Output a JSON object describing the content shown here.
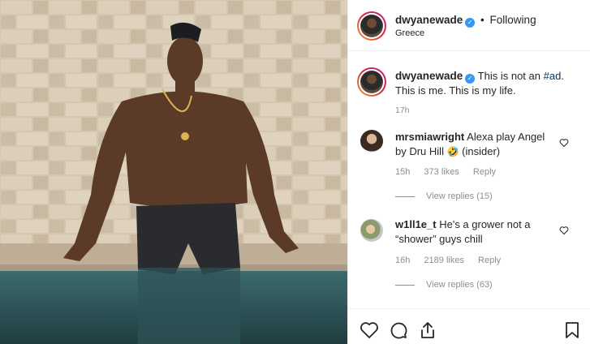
{
  "post": {
    "username": "dwyanewade",
    "follow_dot": "•",
    "follow_status": "Following",
    "location": "Greece",
    "verified_icon": "verified-badge-icon",
    "caption": {
      "username": "dwyanewade",
      "text_before": "This is not an ",
      "hashtag": "#ad",
      "text_after": ". This is me. This is my life.",
      "time": "17h"
    }
  },
  "comments": [
    {
      "username": "mrsmiawright",
      "text_before": "Alexa play Angel by Dru Hill ",
      "emoji": "🤣",
      "text_after": " (insider)",
      "time": "15h",
      "likes": "373 likes",
      "reply_label": "Reply",
      "view_replies": "View replies (15)"
    },
    {
      "username": "w1ll1e_t",
      "text": "He's a grower not a “shower” guys chill",
      "time": "16h",
      "likes": "2189 likes",
      "reply_label": "Reply",
      "view_replies": "View replies (63)"
    }
  ],
  "actions": {
    "icons": [
      "heart-icon",
      "comment-icon",
      "share-icon",
      "bookmark-icon"
    ]
  },
  "colors": {
    "text": "#262626",
    "secondary": "#8e8e8e",
    "verified": "#3897f0",
    "hashtag": "#003569",
    "border": "#efefef"
  }
}
